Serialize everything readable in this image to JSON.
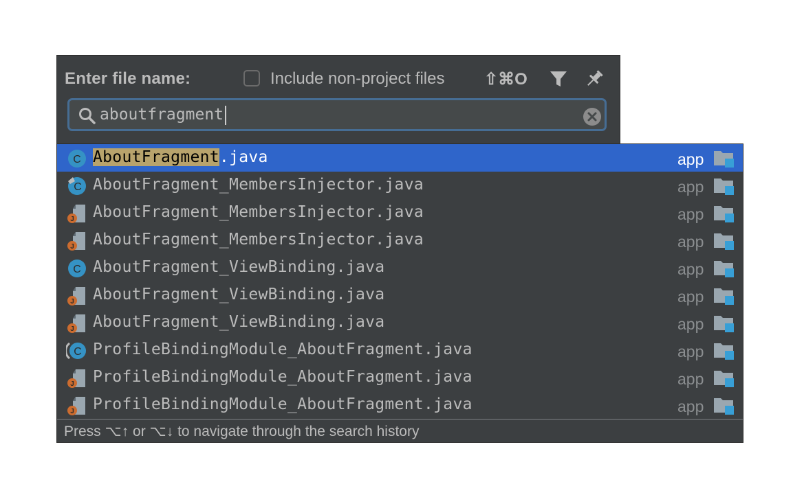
{
  "header": {
    "title": "Enter file name:",
    "include_label": "Include non-project files",
    "include_checked": false,
    "shortcut": "⇧⌘O",
    "filter_icon": "filter-icon",
    "pin_icon": "pin-icon"
  },
  "search": {
    "value": "aboutfragment",
    "icon": "search-icon",
    "clear_icon": "clear-icon"
  },
  "results": [
    {
      "highlight": "AboutFragment",
      "rest": ".java",
      "module": "app",
      "icon": "class-icon",
      "selected": true
    },
    {
      "highlight": "",
      "rest": "AboutFragment_MembersInjector.java",
      "module": "app",
      "icon": "generated-class-icon",
      "selected": false
    },
    {
      "highlight": "",
      "rest": "AboutFragment_MembersInjector.java",
      "module": "app",
      "icon": "java-file-icon",
      "selected": false
    },
    {
      "highlight": "",
      "rest": "AboutFragment_MembersInjector.java",
      "module": "app",
      "icon": "java-file-icon",
      "selected": false
    },
    {
      "highlight": "",
      "rest": "AboutFragment_ViewBinding.java",
      "module": "app",
      "icon": "class-icon",
      "selected": false
    },
    {
      "highlight": "",
      "rest": "AboutFragment_ViewBinding.java",
      "module": "app",
      "icon": "java-file-icon",
      "selected": false
    },
    {
      "highlight": "",
      "rest": "AboutFragment_ViewBinding.java",
      "module": "app",
      "icon": "java-file-icon",
      "selected": false
    },
    {
      "highlight": "",
      "rest": "ProfileBindingModule_AboutFragment.java",
      "module": "app",
      "icon": "module-class-icon",
      "selected": false
    },
    {
      "highlight": "",
      "rest": "ProfileBindingModule_AboutFragment.java",
      "module": "app",
      "icon": "java-file-icon",
      "selected": false
    },
    {
      "highlight": "",
      "rest": "ProfileBindingModule_AboutFragment.java",
      "module": "app",
      "icon": "java-file-icon",
      "selected": false
    }
  ],
  "footer": {
    "hint": "Press ⌥↑ or ⌥↓ to navigate through the search history"
  },
  "colors": {
    "panel_bg": "#3c3f41",
    "selection": "#2f65ca",
    "match_highlight": "#b8a36c",
    "search_border": "#466d94"
  }
}
